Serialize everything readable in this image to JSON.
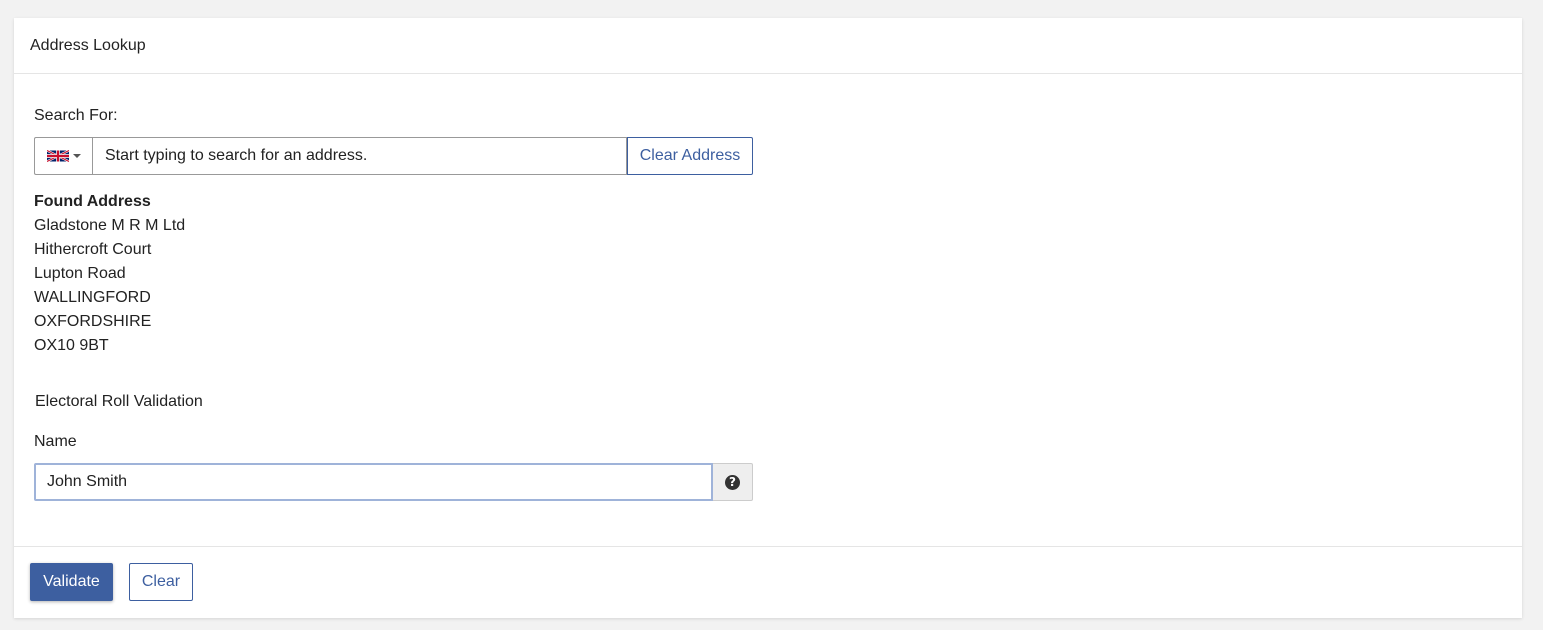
{
  "panel": {
    "title": "Address Lookup"
  },
  "search": {
    "label": "Search For:",
    "country_flag_icon": "uk-flag-icon",
    "placeholder": "Start typing to search for an address.",
    "value": "",
    "clear_address_label": "Clear Address"
  },
  "found_address": {
    "title": "Found Address",
    "lines": [
      "Gladstone M R M Ltd",
      "Hithercroft Court",
      "Lupton Road",
      "WALLINGFORD",
      "OXFORDSHIRE",
      "OX10 9BT"
    ]
  },
  "electoral": {
    "section_label": "Electoral Roll Validation",
    "name_label": "Name",
    "name_value": "John Smith",
    "help_icon": "question-circle-icon"
  },
  "footer": {
    "validate_label": "Validate",
    "clear_label": "Clear"
  },
  "colors": {
    "accent": "#3d5fa0",
    "background": "#f2f2f2",
    "panel": "#ffffff"
  }
}
